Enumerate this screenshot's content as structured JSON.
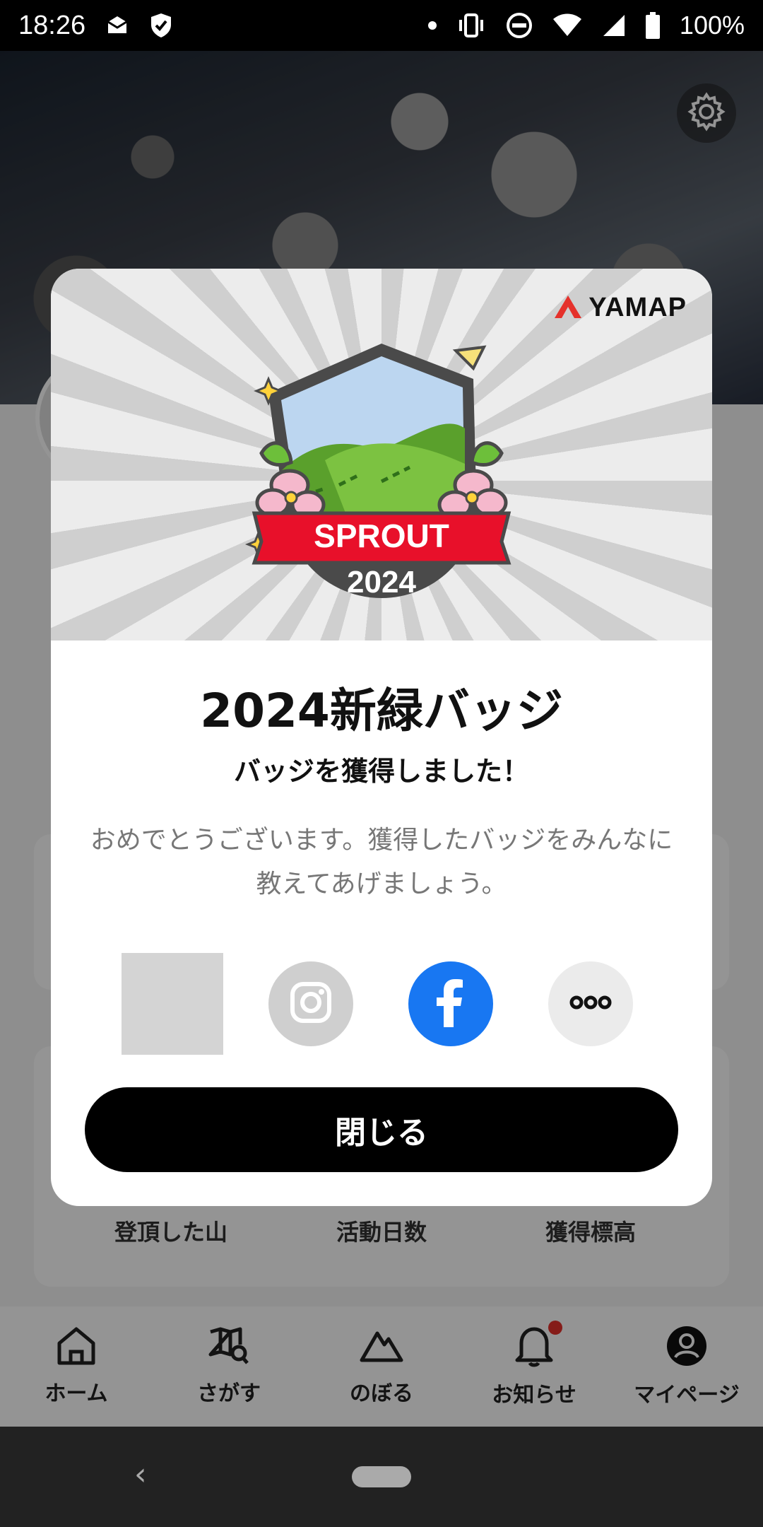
{
  "status_bar": {
    "time": "18:26",
    "battery": "100%"
  },
  "modal": {
    "brand": "YAMAP",
    "badge": {
      "ribbon_text": "SPROUT",
      "year_text": "2024"
    },
    "title": "2024新緑バッジ",
    "subtitle": "バッジを獲得しました！",
    "message": "おめでとうございます。獲得したバッジをみんなに教えてあげましょう。",
    "share": {
      "icons": [
        "image-thumbnail",
        "instagram-icon",
        "facebook-icon",
        "more-icon"
      ]
    },
    "close_label": "閉じる"
  },
  "background": {
    "stats": [
      "登頂した山",
      "活動日数",
      "獲得標高"
    ]
  },
  "bottom_nav": {
    "items": [
      {
        "label": "ホーム",
        "icon": "home-icon"
      },
      {
        "label": "さがす",
        "icon": "map-search-icon"
      },
      {
        "label": "のぼる",
        "icon": "mountain-icon"
      },
      {
        "label": "お知らせ",
        "icon": "bell-icon"
      },
      {
        "label": "マイページ",
        "icon": "user-icon"
      }
    ]
  },
  "colors": {
    "accent_red": "#e5312b",
    "facebook_blue": "#1877f2",
    "primary_button": "#000000"
  }
}
